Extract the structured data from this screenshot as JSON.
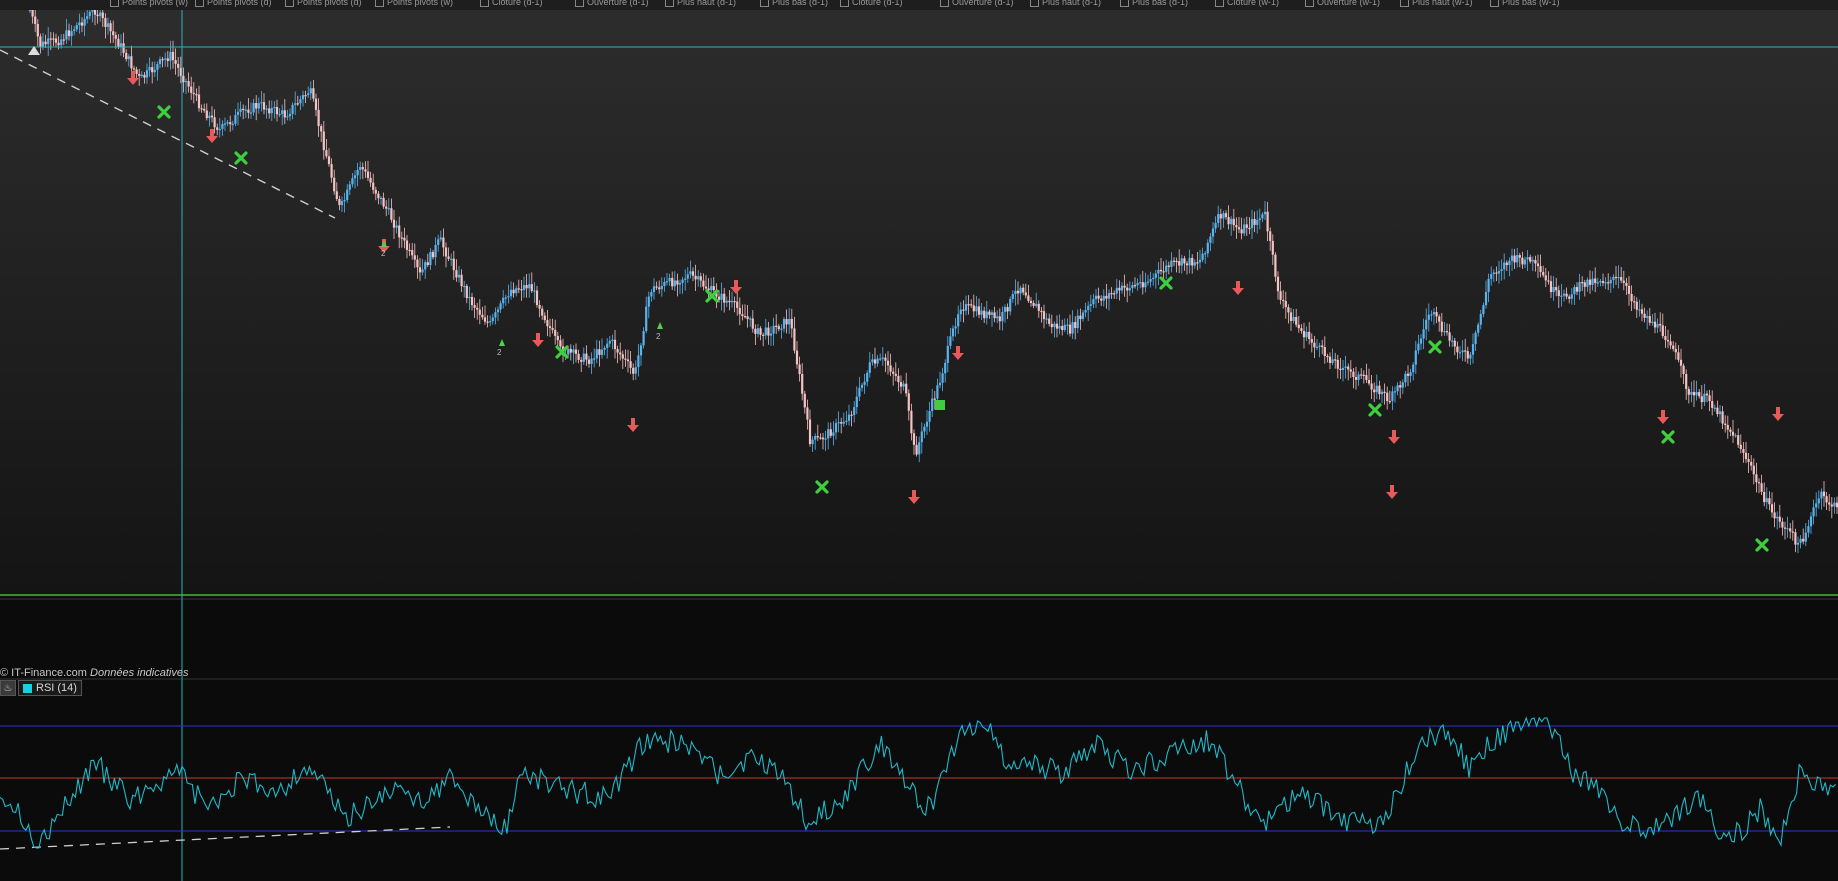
{
  "legend": {
    "items": [
      "Points pivots (w)",
      "Points pivots (d)",
      "Points pivots (d)",
      "Points pivots (w)",
      "Clôture (d-1)",
      "Ouverture (d-1)",
      "Plus haut (d-1)",
      "Plus bas (d-1)",
      "Clôture (d-1)",
      "Ouverture (d-1)",
      "Plus haut (d-1)",
      "Plus bas (d-1)",
      "Clôture (w-1)",
      "Ouverture (w-1)",
      "Plus haut (w-1)",
      "Plus bas (w-1)"
    ]
  },
  "copyright": {
    "source": "© IT-Finance.com",
    "note": "Données indicatives"
  },
  "rsi": {
    "label": "RSI (14)",
    "period": 14,
    "upper_level": 70,
    "middle_level": 50,
    "lower_level": 30
  },
  "colors": {
    "background": "#0b0b0b",
    "candle_up": "#58b4ee",
    "candle_down": "#f6c2c2",
    "rsi_line": "#1fb9c9",
    "cursor_line": "#2fb0c0",
    "separator_green": "#4caf3c",
    "rsi_band_blue": "#2c36c8",
    "rsi_mid_red": "#d23030",
    "sell_arrow": "#e85a5a",
    "exit_cross": "#3ecf3e"
  },
  "icons": [
    "bell-icon",
    "sell-arrow-icon",
    "buy-arrow-icon",
    "exit-cross-icon",
    "square-signal-icon"
  ],
  "signals": {
    "sell_arrows": 13,
    "exit_crosses": 10,
    "labels": [
      "2",
      "2",
      "2"
    ]
  }
}
